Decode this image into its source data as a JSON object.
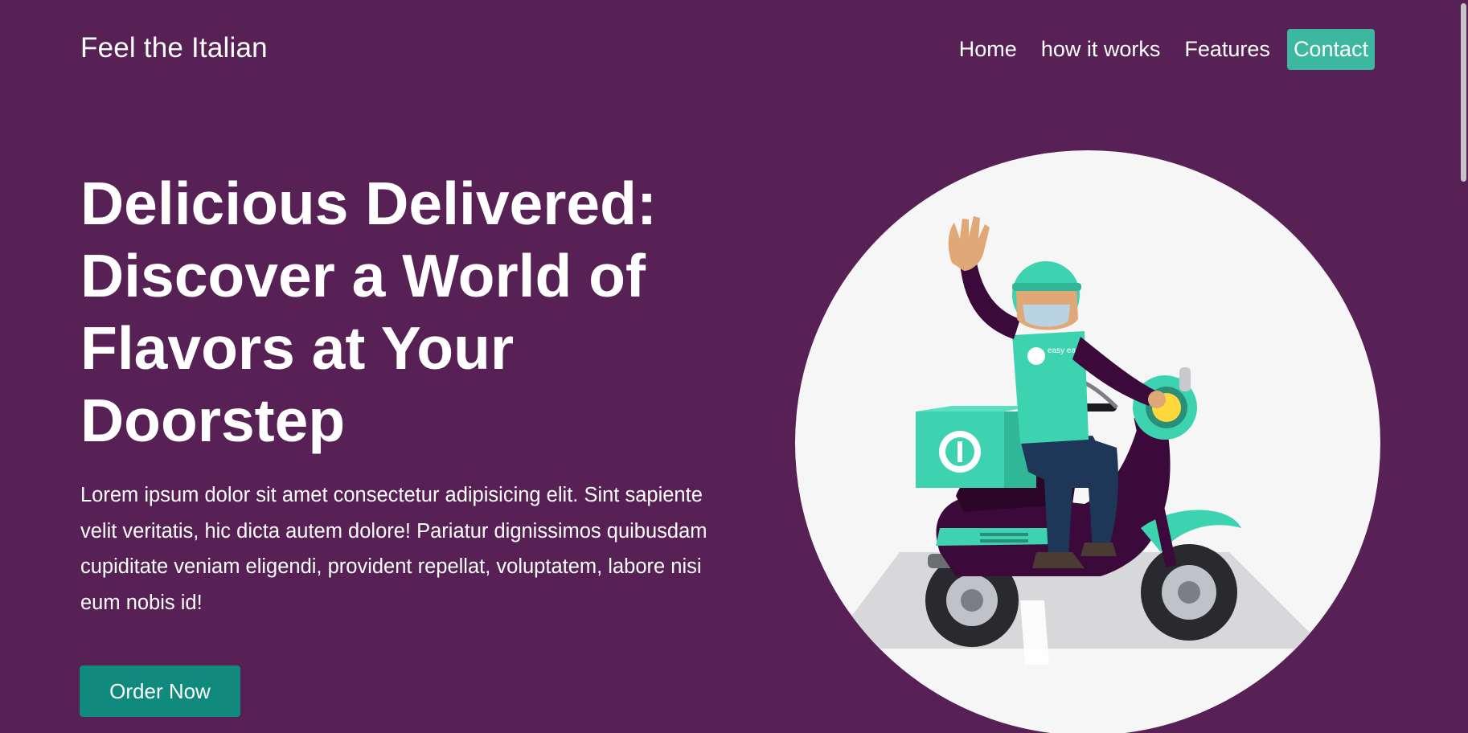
{
  "nav": {
    "brand": "Feel the Italian",
    "links": [
      {
        "label": "Home"
      },
      {
        "label": "how it works"
      },
      {
        "label": "Features"
      },
      {
        "label": "Contact"
      }
    ]
  },
  "hero": {
    "title": "Delicious Delivered: Discover a World of Flavors at Your Doorstep",
    "text": "Lorem ipsum dolor sit amet consectetur adipisicing elit. Sint sapiente velit veritatis, hic dicta autem dolore! Pariatur dignissimos quibusdam cupiditate veniam eligendi, provident repellat, voluptatem, labore nisi eum nobis id!",
    "cta": "Order Now"
  },
  "illustration": {
    "subject": "delivery-rider-on-scooter",
    "helmet_badge": "easy eat"
  },
  "colors": {
    "background": "#582155",
    "contact_button": "#3bb89f",
    "order_button": "#108a7c",
    "accent_mint": "#3ed3b0",
    "scooter": "#3c0a3a"
  }
}
